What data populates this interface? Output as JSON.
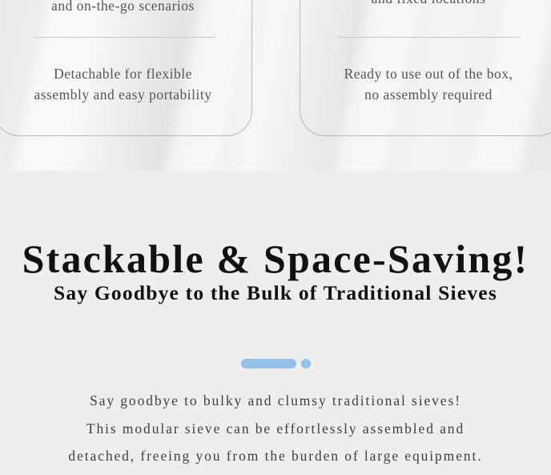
{
  "features": {
    "left": {
      "top_text": "and on-the-go scenarios",
      "bottom_lines": [
        "Detachable for flexible",
        "assembly and easy portability"
      ]
    },
    "right": {
      "top_text": "and fixed locations",
      "bottom_lines": [
        "Ready to use out of the box,",
        "no assembly required"
      ]
    }
  },
  "section": {
    "headline": "Stackable & Space-Saving!",
    "subheadline": "Say Goodbye to the Bulk of Traditional Sieves",
    "body_lines": [
      "Say goodbye to bulky and clumsy traditional sieves!",
      "This modular sieve can be effortlessly assembled and",
      "detached, freeing you from the burden of large equipment."
    ]
  },
  "colors": {
    "accent": "#93c1ea",
    "background": "#efedee",
    "heading": "#111111"
  }
}
